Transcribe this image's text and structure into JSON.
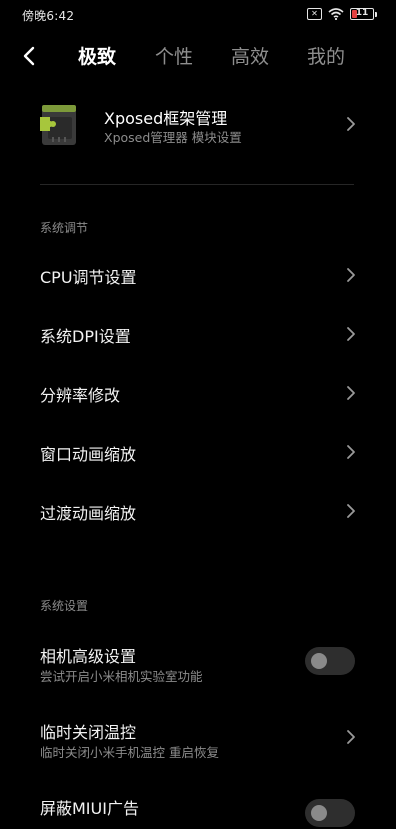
{
  "status_bar": {
    "time": "傍晚6:42",
    "sim_icon": "sim-off-icon",
    "wifi_icon": "wifi-icon",
    "battery_level": "11",
    "battery_color": "#e54141"
  },
  "nav": {
    "back_icon": "back-arrow-icon",
    "tabs": [
      {
        "label": "极致"
      },
      {
        "label": "个性"
      },
      {
        "label": "高效"
      },
      {
        "label": "我的"
      }
    ],
    "active_tab": "极致"
  },
  "xposed": {
    "icon": "xposed-puzzle-icon",
    "title": "Xposed框架管理",
    "subtitle": "Xposed管理器 模块设置"
  },
  "sections": {
    "tuning": {
      "title": "系统调节",
      "items": [
        {
          "label": "CPU调节设置"
        },
        {
          "label": "系统DPI设置"
        },
        {
          "label": "分辨率修改"
        },
        {
          "label": "窗口动画缩放"
        },
        {
          "label": "过渡动画缩放"
        }
      ]
    },
    "settings": {
      "title": "系统设置",
      "items": [
        {
          "label": "相机高级设置",
          "subtitle": "尝试开启小米相机实验室功能",
          "control": "toggle",
          "on": false
        },
        {
          "label": "临时关闭温控",
          "subtitle": "临时关闭小米手机温控 重启恢复",
          "control": "chevron"
        },
        {
          "label": "屏蔽MIUI广告",
          "control": "toggle",
          "on": false
        }
      ]
    }
  },
  "colors": {
    "background": "#000000",
    "text_primary": "#f2f2f2",
    "text_secondary": "#8c8c8c",
    "toggle_off_track": "#2e2e2e"
  }
}
